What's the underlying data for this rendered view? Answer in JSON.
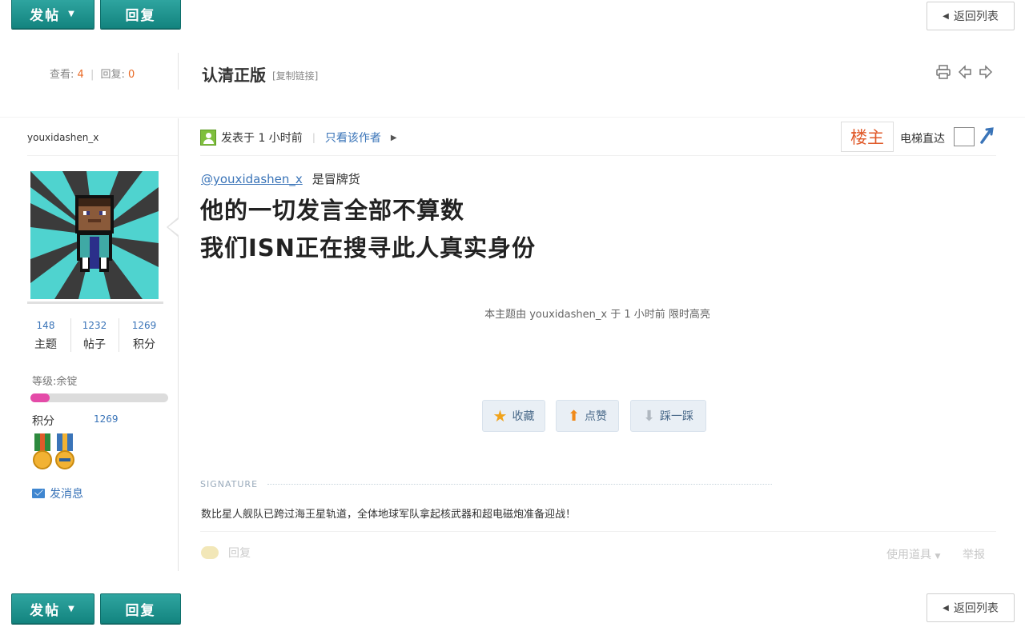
{
  "toolbar": {
    "new_post_label": "发帖",
    "reply_label": "回复",
    "back_to_list_label": "返回列表"
  },
  "thread": {
    "views_label": "查看:",
    "views": "4",
    "replies_sep": "|",
    "replies_label": "回复:",
    "replies": "0",
    "title": "认清正版",
    "copy_link_label": "[复制链接]"
  },
  "author": {
    "name": "youxidashen_x",
    "stats": [
      {
        "value": "148",
        "label": "主题"
      },
      {
        "value": "1232",
        "label": "帖子"
      },
      {
        "value": "1269",
        "label": "积分"
      }
    ],
    "level_label": "等级:余锭",
    "level_progress": 0.14,
    "points_label": "积分",
    "points_value": "1269",
    "send_message_label": "发消息"
  },
  "post": {
    "posted_at": "发表于 1 小时前",
    "separator": "|",
    "only_author_label": "只看该作者",
    "floor_label": "楼主",
    "elevator_label": "电梯直达",
    "mention": "@youxidashen_x",
    "mention_suffix": "是冒牌货",
    "line1": "他的一切发言全部不算数",
    "line2": "我们ISN正在搜寻此人真实身份",
    "highlight_note": "本主题由 youxidashen_x 于 1 小时前 限时高亮",
    "favorite_label": "收藏",
    "like_label": "点赞",
    "dislike_label": "踩一踩",
    "signature_label": "SIGNATURE",
    "signature_text": "数比星人舰队已跨过海王星轨道，全体地球军队拿起核武器和超电磁炮准备迎战！",
    "reply_label": "回复",
    "use_tool_label": "使用道具",
    "report_label": "举报"
  },
  "icons": {
    "print": "printer-icon",
    "prev": "prev-thread-icon",
    "next": "next-thread-icon",
    "online": "online-user-icon",
    "mail": "mail-icon",
    "star": "star-icon",
    "up": "thumb-up-icon",
    "down": "thumb-down-icon"
  },
  "colors": {
    "brand_green": "#13847f",
    "link_blue": "#3a74b8",
    "accent_orange": "#e96a25",
    "level_bar_pink": "#e44ba8"
  }
}
